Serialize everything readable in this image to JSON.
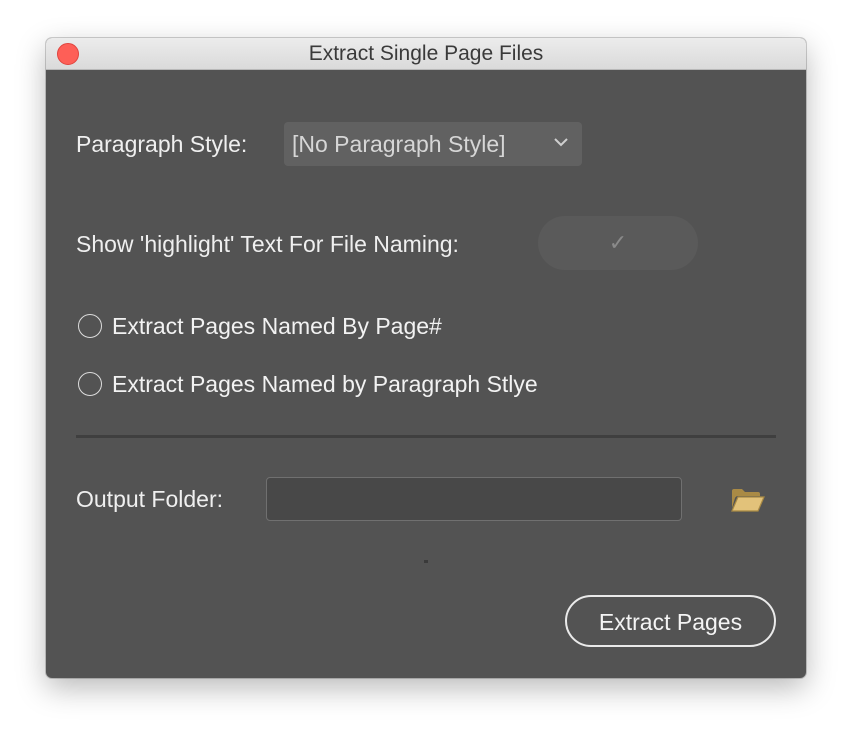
{
  "window": {
    "title": "Extract Single Page Files"
  },
  "paragraph_style": {
    "label": "Paragraph Style:",
    "selected_value": "[No Paragraph Style]"
  },
  "highlight_toggle": {
    "label": "Show 'highlight' Text For File Naming:",
    "check_glyph": "✓"
  },
  "options": [
    {
      "label": "Extract Pages Named By Page#",
      "selected": false
    },
    {
      "label": "Extract Pages Named by Paragraph Stlye",
      "selected": false
    }
  ],
  "output_folder": {
    "label": "Output Folder:",
    "value": "",
    "placeholder": ""
  },
  "actions": {
    "extract_label": "Extract Pages"
  },
  "colors": {
    "panel_bg": "#535353",
    "close_button": "#fe5f57",
    "folder_icon": "#d7b46a"
  }
}
